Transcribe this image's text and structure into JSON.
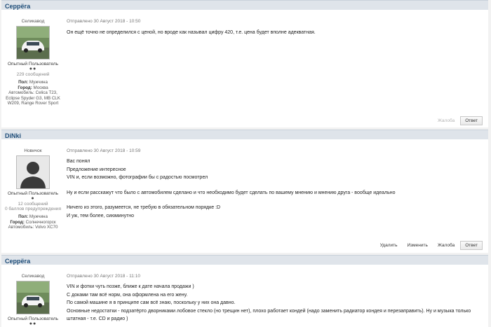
{
  "posts": [
    {
      "author": "Серрёга",
      "rank": "Селикавод",
      "group": "Опытный Пользователь",
      "pips": "●●",
      "post_count": "229 сообщений",
      "fields": {
        "gender_label": "Пол:",
        "gender": "Мужчина",
        "city_label": "Город:",
        "city": "Москва",
        "cars_label": "Автомобиль:",
        "cars": "Celica T23, Eclipse Spyder G3, MB CLK W209, Range Rover Sport"
      },
      "date": "Отправлено 30 Август 2018 - 10:50",
      "body": [
        "Он ещё точно не определился с ценой, но вроде как называл цифру 420, т.е. цена будет вполне адекватная."
      ],
      "actions": {
        "report": "Жалоба",
        "reply": "Ответ"
      }
    },
    {
      "author": "DiNki",
      "rank": "Новичок",
      "group": "Опытный Пользователь",
      "pips": "●",
      "post_count": "12 сообщений",
      "warnings": "0 баллов предупреждения",
      "fields": {
        "gender_label": "Пол:",
        "gender": "Мужчина",
        "city_label": "Город:",
        "city": "Солнечногорск",
        "cars_label": "Автомобиль:",
        "cars": "Volvo XC70"
      },
      "date": "Отправлено 30 Август 2018 - 10:59",
      "body": [
        "Вас понял",
        "Предложение интересное",
        "VIN и, если возможно, фотографии бы с радостью посмотрел",
        "Ну и если расскажут что было с автомобилем сделано и что необходимо будет сделать по вашему мнению и мнению друга - вообще идеально",
        "Ничего из этого, разумеется, не требую в обязательном порядке :D",
        "И уж, тем более, сиюминутно"
      ],
      "actions": {
        "delete": "Удалить",
        "edit": "Изменить",
        "report": "Жалоба",
        "reply": "Ответ"
      }
    },
    {
      "author": "Серрёга",
      "rank": "Селикавод",
      "group": "Опытный Пользователь",
      "pips": "●●",
      "date": "Отправлено 30 Август 2018 - 11:10",
      "body": [
        "VIN и фотки чуть позже, ближе к дате начала продажи )",
        "С доками там всё норм, она оформлена на его жену.",
        "По самой машине я в принципе сам всё знаю, поскольку у них она давно.",
        "Основные недостатки - подзатёрто дворниками лобовое стекло (но трещин нет), плохо работает кондей (надо заменить радиатор кондея и перезаправить). Ну и музыка только штатная - т.е. CD и радио )"
      ]
    }
  ]
}
